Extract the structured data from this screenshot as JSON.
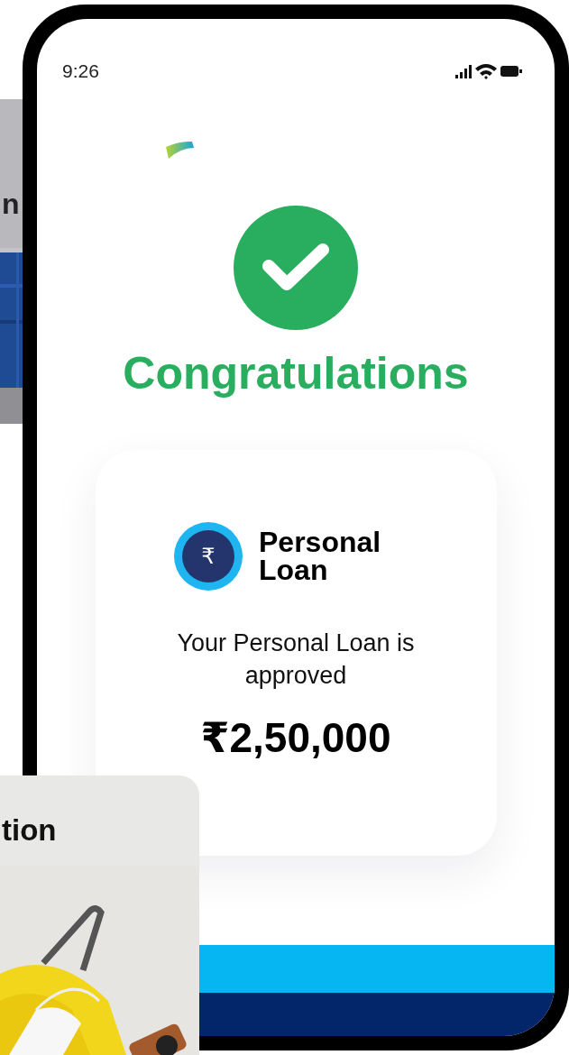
{
  "status_bar": {
    "time": "9:26"
  },
  "success": {
    "title": "Congratulations"
  },
  "loan_card": {
    "product": "Personal Loan",
    "icon_symbol": "₹",
    "message": "Your Personal Loan is approved",
    "amount": "₹2,50,000"
  },
  "side_cards": [
    {
      "text": "n"
    },
    {
      "text": "tion"
    }
  ]
}
